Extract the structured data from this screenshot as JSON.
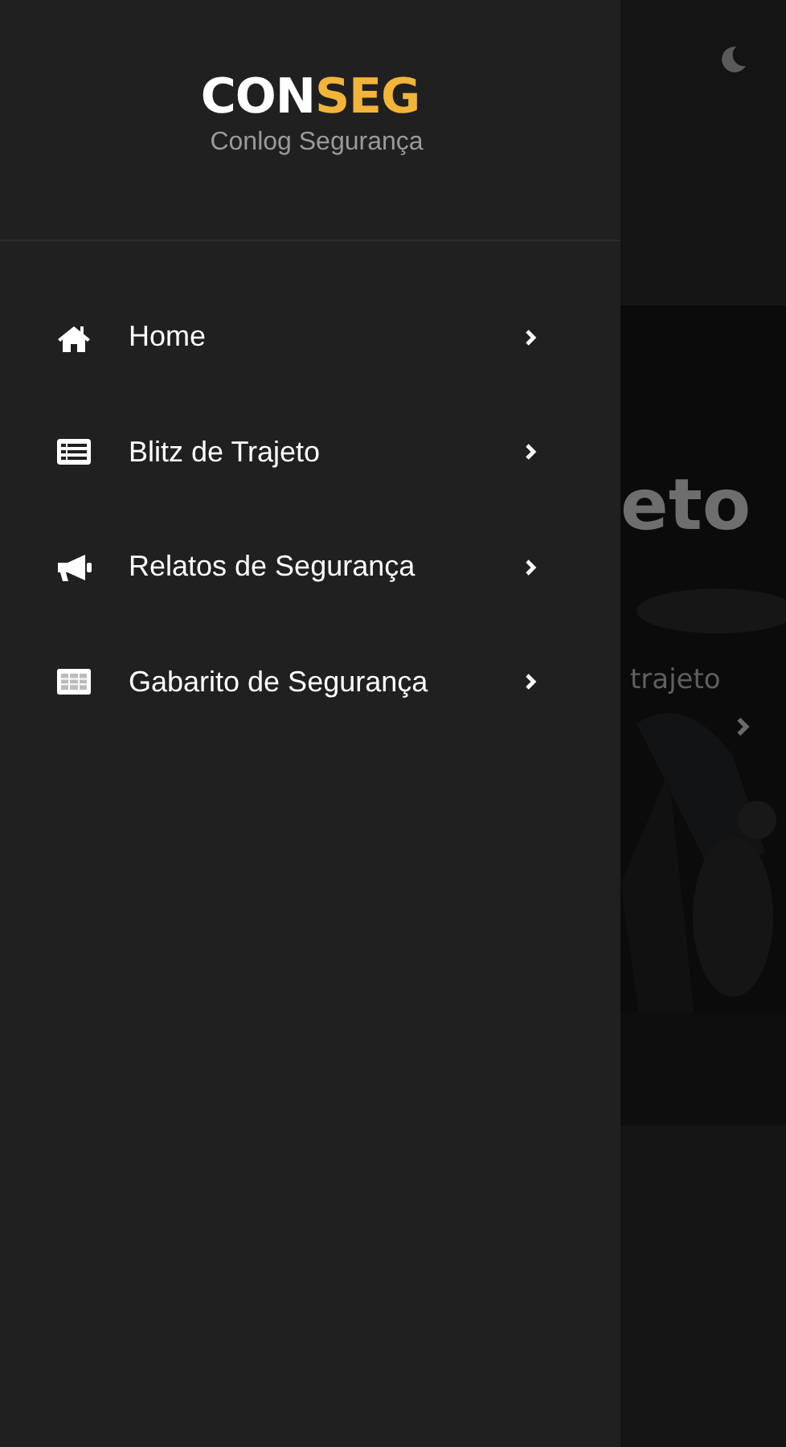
{
  "drawer": {
    "logo": {
      "text": "CON",
      "accent": "SEG"
    },
    "subtitle": "Conlog Segurança",
    "menu": [
      {
        "kind": "home",
        "label": "Home"
      },
      {
        "kind": "list",
        "label": "Blitz de Trajeto"
      },
      {
        "kind": "megaphone",
        "label": "Relatos de Segurança"
      },
      {
        "kind": "table",
        "label": "Gabarito de Segurança"
      }
    ]
  },
  "background_page": {
    "hero": {
      "kind": "picture",
      "title": "eto",
      "subtitle": "trajeto"
    }
  }
}
